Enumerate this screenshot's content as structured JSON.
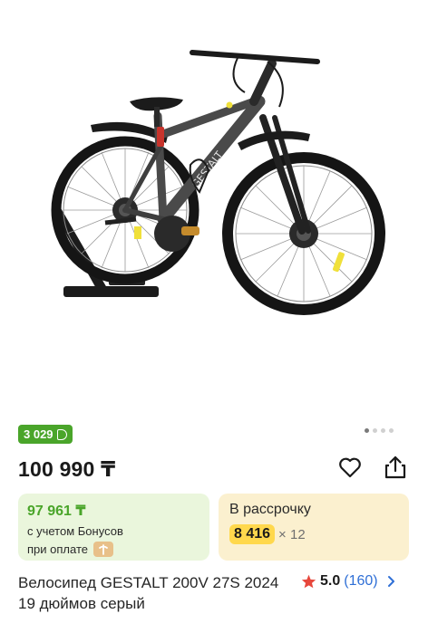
{
  "gallery": {
    "image_alt": "Велосипед GESTALT 200V 27S",
    "frame_color": "#4a4a4a",
    "slides_count": 4,
    "active_slide": 1
  },
  "bonus_badge": {
    "value": "3 029",
    "icon": "bonus-b-icon",
    "color": "#4aa52a"
  },
  "price": {
    "value": "100 990 ₸"
  },
  "actions": {
    "favorite_icon": "heart-icon",
    "share_icon": "share-icon"
  },
  "bonus_card": {
    "amount": "97 961 ₸",
    "line1": "с учетом Бонусов",
    "line2": "при оплате"
  },
  "installment_card": {
    "title": "В рассрочку",
    "amount": "8 416",
    "multiplier": "× 12"
  },
  "product": {
    "title": "Велосипед GESTALT 200V 27S 2024 19 дюймов серый",
    "rating": "5.0",
    "reviews": "(160)"
  }
}
